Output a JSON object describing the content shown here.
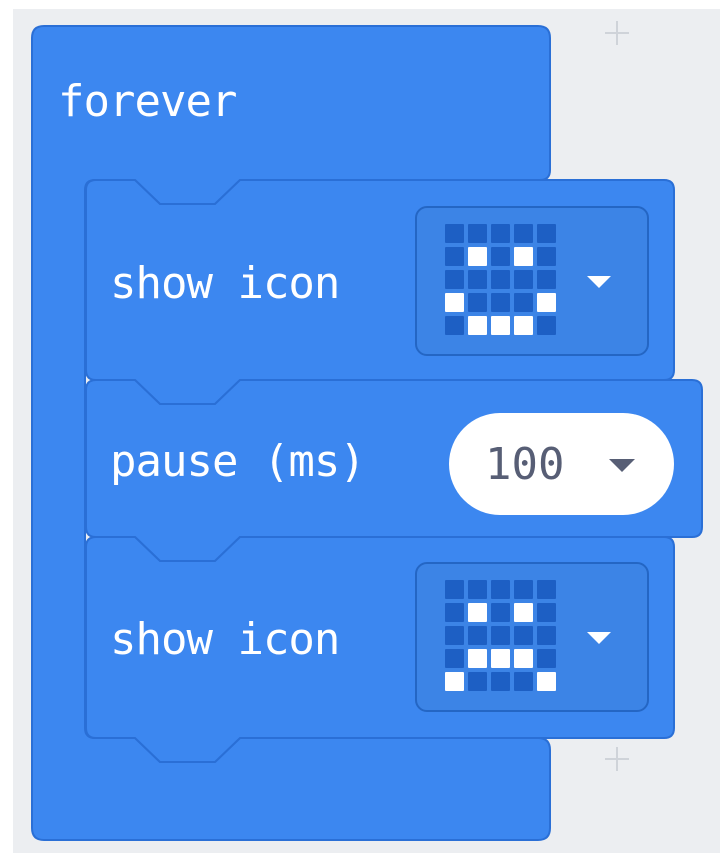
{
  "blocks": {
    "forever": {
      "label": "forever"
    },
    "show_icon_1": {
      "label": "show icon",
      "icon": "happy-face-icon",
      "leds": [
        [
          0,
          0,
          0,
          0,
          0
        ],
        [
          0,
          1,
          0,
          1,
          0
        ],
        [
          0,
          0,
          0,
          0,
          0
        ],
        [
          1,
          0,
          0,
          0,
          1
        ],
        [
          0,
          1,
          1,
          1,
          0
        ]
      ]
    },
    "pause": {
      "label": "pause (ms)",
      "value": "100"
    },
    "show_icon_2": {
      "label": "show icon",
      "icon": "sad-face-icon",
      "leds": [
        [
          0,
          0,
          0,
          0,
          0
        ],
        [
          0,
          1,
          0,
          1,
          0
        ],
        [
          0,
          0,
          0,
          0,
          0
        ],
        [
          0,
          1,
          1,
          1,
          0
        ],
        [
          1,
          0,
          0,
          0,
          1
        ]
      ]
    }
  },
  "colors": {
    "block": "#3c87f0",
    "block_border": "#2a6fd6",
    "workspace": "#eceef1",
    "led_on": "#ffffff",
    "led_off": "#1d5fc4"
  }
}
